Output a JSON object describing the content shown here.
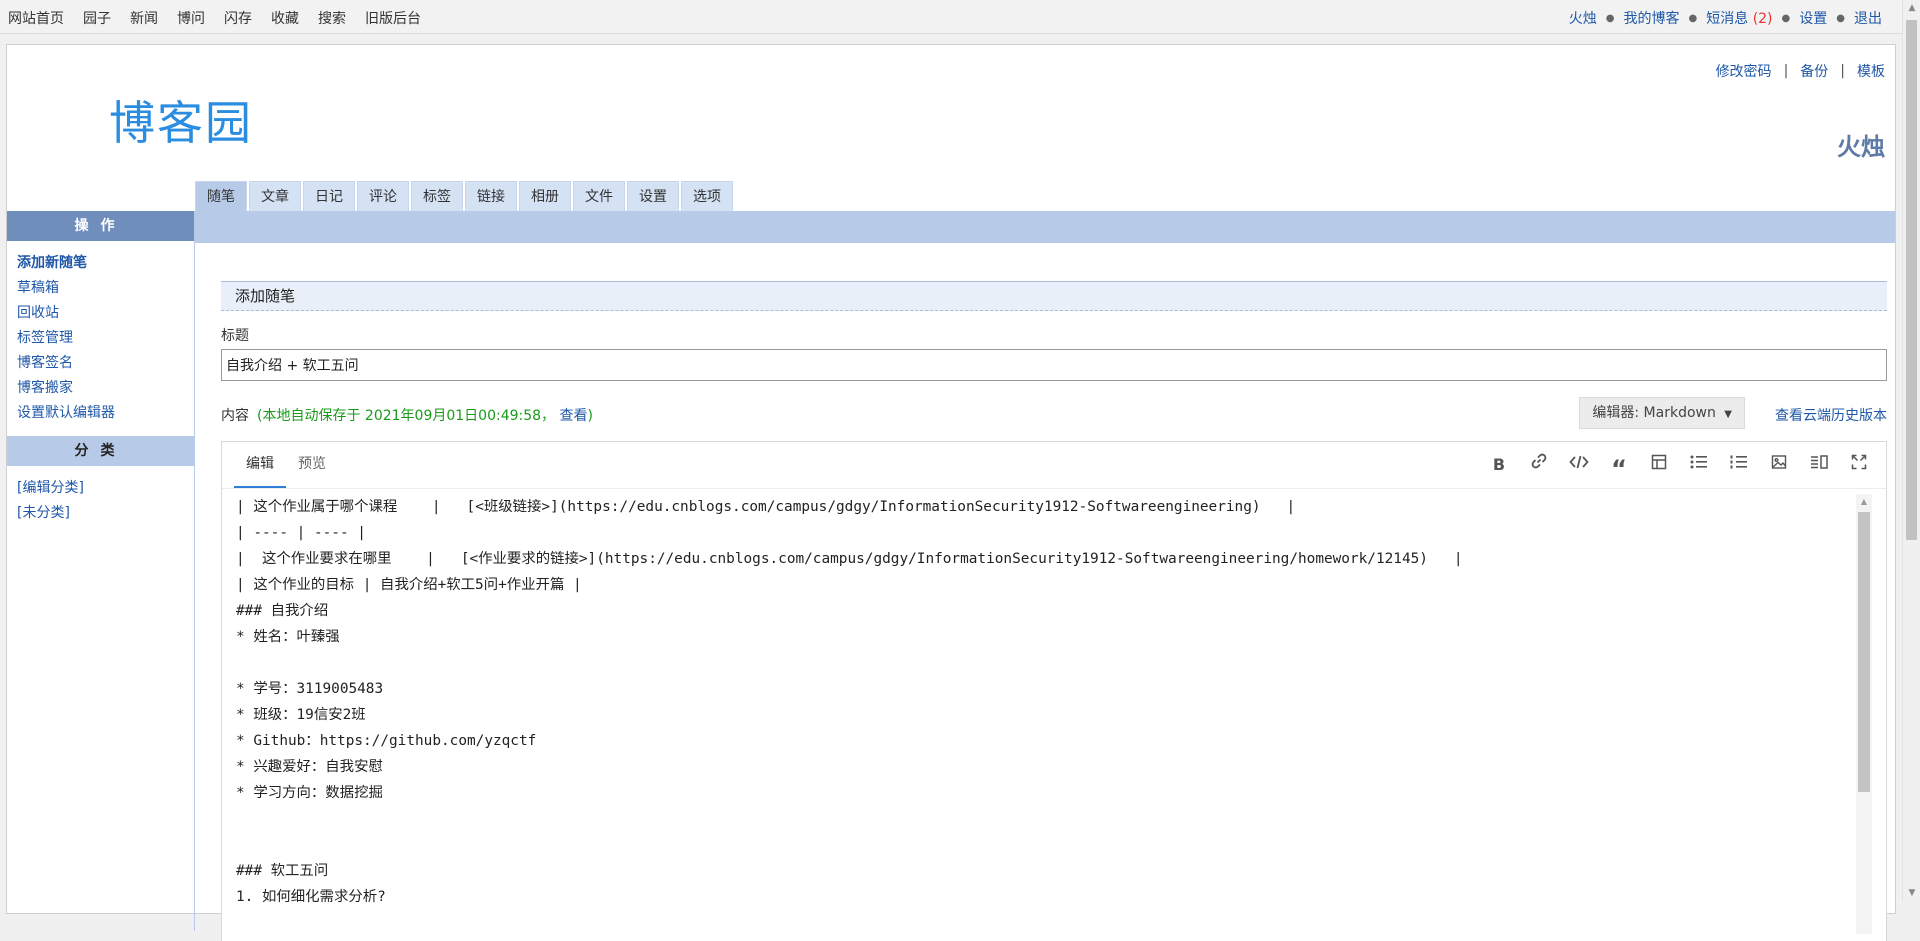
{
  "topnav": {
    "left": [
      "网站首页",
      "园子",
      "新闻",
      "博问",
      "闪存",
      "收藏",
      "搜索",
      "旧版后台"
    ],
    "user": "火烛",
    "my_blog": "我的博客",
    "messages_label": "短消息",
    "messages_count": "(2)",
    "settings": "设置",
    "logout": "退出"
  },
  "header": {
    "logo_text": "博客园",
    "links": [
      "修改密码",
      "备份",
      "模板"
    ],
    "owner": "火烛"
  },
  "tabs": [
    "随笔",
    "文章",
    "日记",
    "评论",
    "标签",
    "链接",
    "相册",
    "文件",
    "设置",
    "选项"
  ],
  "sidebar": {
    "ops_title": "操作",
    "ops": [
      "添加新随笔",
      "草稿箱",
      "回收站",
      "标签管理",
      "博客签名",
      "博客搬家",
      "设置默认编辑器"
    ],
    "cat_title": "分类",
    "cats": [
      "[编辑分类]",
      "[未分类]"
    ]
  },
  "main": {
    "section_title": "添加随笔",
    "title_label": "标题",
    "title_value": "自我介绍 + 软工五问",
    "content_label": "内容",
    "autosave_text": "(本地自动保存于 2021年09月01日00:49:58，",
    "autosave_view": "查看",
    "autosave_close": ")",
    "editor_select": "编辑器: Markdown",
    "history_link": "查看云端历史版本",
    "editor_tabs": [
      "编辑",
      "预览"
    ],
    "toolbar": [
      "bold-icon",
      "link-icon",
      "code-icon",
      "quote-icon",
      "table-icon",
      "unordered-list-icon",
      "ordered-list-icon",
      "image-icon",
      "split-view-icon",
      "fullscreen-icon"
    ],
    "code_lines": [
      "| 这个作业属于哪个课程    |   [<班级链接>](https://edu.cnblogs.com/campus/gdgy/InformationSecurity1912-Softwareengineering)   |",
      "| ---- | ---- |",
      "|  这个作业要求在哪里    |   [<作业要求的链接>](https://edu.cnblogs.com/campus/gdgy/InformationSecurity1912-Softwareengineering/homework/12145)   |",
      "| 这个作业的目标 | 自我介绍+软工5问+作业开篇 |",
      "### 自我介绍",
      "* 姓名：叶臻强",
      "",
      "* 学号：3119005483",
      "* 班级：19信安2班",
      "* Github：https://github.com/yzqctf",
      "* 兴趣爱好：自我安慰",
      "* 学习方向：数据挖掘",
      "",
      "",
      "### 软工五问",
      "1. 如何细化需求分析?"
    ]
  }
}
